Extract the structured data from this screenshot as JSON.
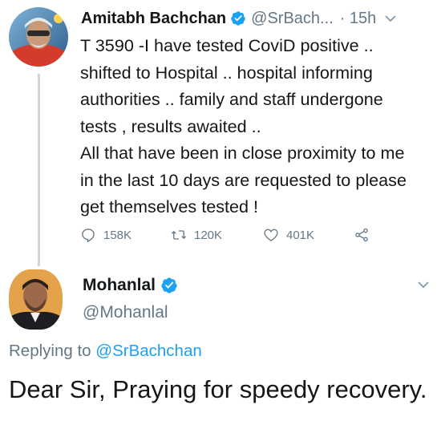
{
  "tweet": {
    "author_name": "Amitabh Bachchan",
    "author_handle": "@SrBach...",
    "time": "· 15h",
    "text": "T 3590 -I have tested CoviD positive ..\nshifted to Hospital  .. hospital informing\nauthorities .. family and staff undergone\ntests , results awaited ..\nAll that have been in close proximity to me\nin the last 10 days are requested to please\nget themselves tested !",
    "stats": {
      "replies": "158K",
      "retweets": "120K",
      "likes": "401K"
    }
  },
  "reply": {
    "author_name": "Mohanlal",
    "author_handle": "@Mohanlal",
    "replying_prefix": "Replying to ",
    "replying_to": "@SrBachchan",
    "text": "Dear Sir, Praying for speedy recovery."
  },
  "colors": {
    "accent": "#1da1f2",
    "muted": "#657786",
    "text": "#14171a",
    "thread_line": "#ccd6dd"
  },
  "icons": [
    "verified-badge-icon",
    "chevron-down-icon",
    "reply-icon",
    "retweet-icon",
    "like-icon",
    "share-icon"
  ]
}
